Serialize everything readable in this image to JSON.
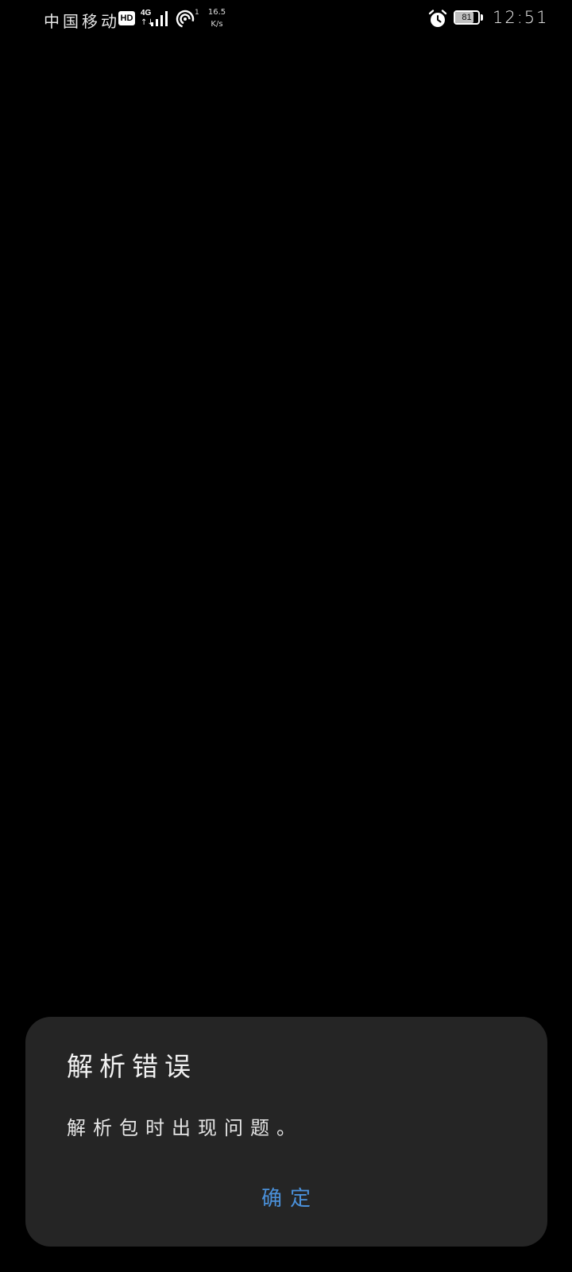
{
  "status_bar": {
    "carrier": "中国移动",
    "hd_label": "HD",
    "network_type": "4G",
    "network_arrows": "↑↓",
    "hotspot_count": "1",
    "speed_value": "16.5",
    "speed_unit": "K/s",
    "battery_level": "81",
    "time": "12:51",
    "icons": [
      "signal-icon",
      "hotspot-icon",
      "alarm-icon",
      "battery-icon"
    ]
  },
  "dialog": {
    "title": "解析错误",
    "message": "解析包时出现问题。",
    "confirm_label": "确定",
    "accent_color": "#4a90d9",
    "background_color": "#252525"
  }
}
